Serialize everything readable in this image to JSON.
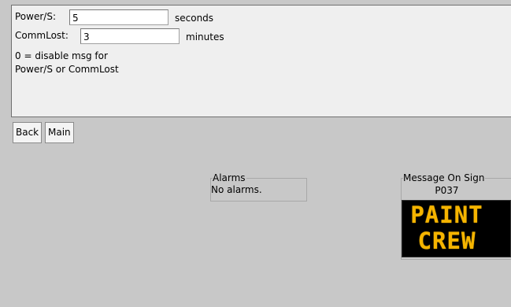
{
  "settings": {
    "power": {
      "label": "Power/S:",
      "value": "5",
      "unit": "seconds"
    },
    "commlost": {
      "label": "CommLost:",
      "value": "3",
      "unit": "minutes"
    },
    "note_line1": "0 = disable msg for",
    "note_line2": "Power/S or CommLost"
  },
  "nav": {
    "back_label": "Back",
    "main_label": "Main"
  },
  "alarms": {
    "title": "Alarms",
    "status": "No alarms."
  },
  "sign": {
    "title": "Message On Sign",
    "code": "P037",
    "line1": "PAINT",
    "line2": "CREW",
    "text_color": "#f5b400",
    "background_color": "#000000"
  }
}
